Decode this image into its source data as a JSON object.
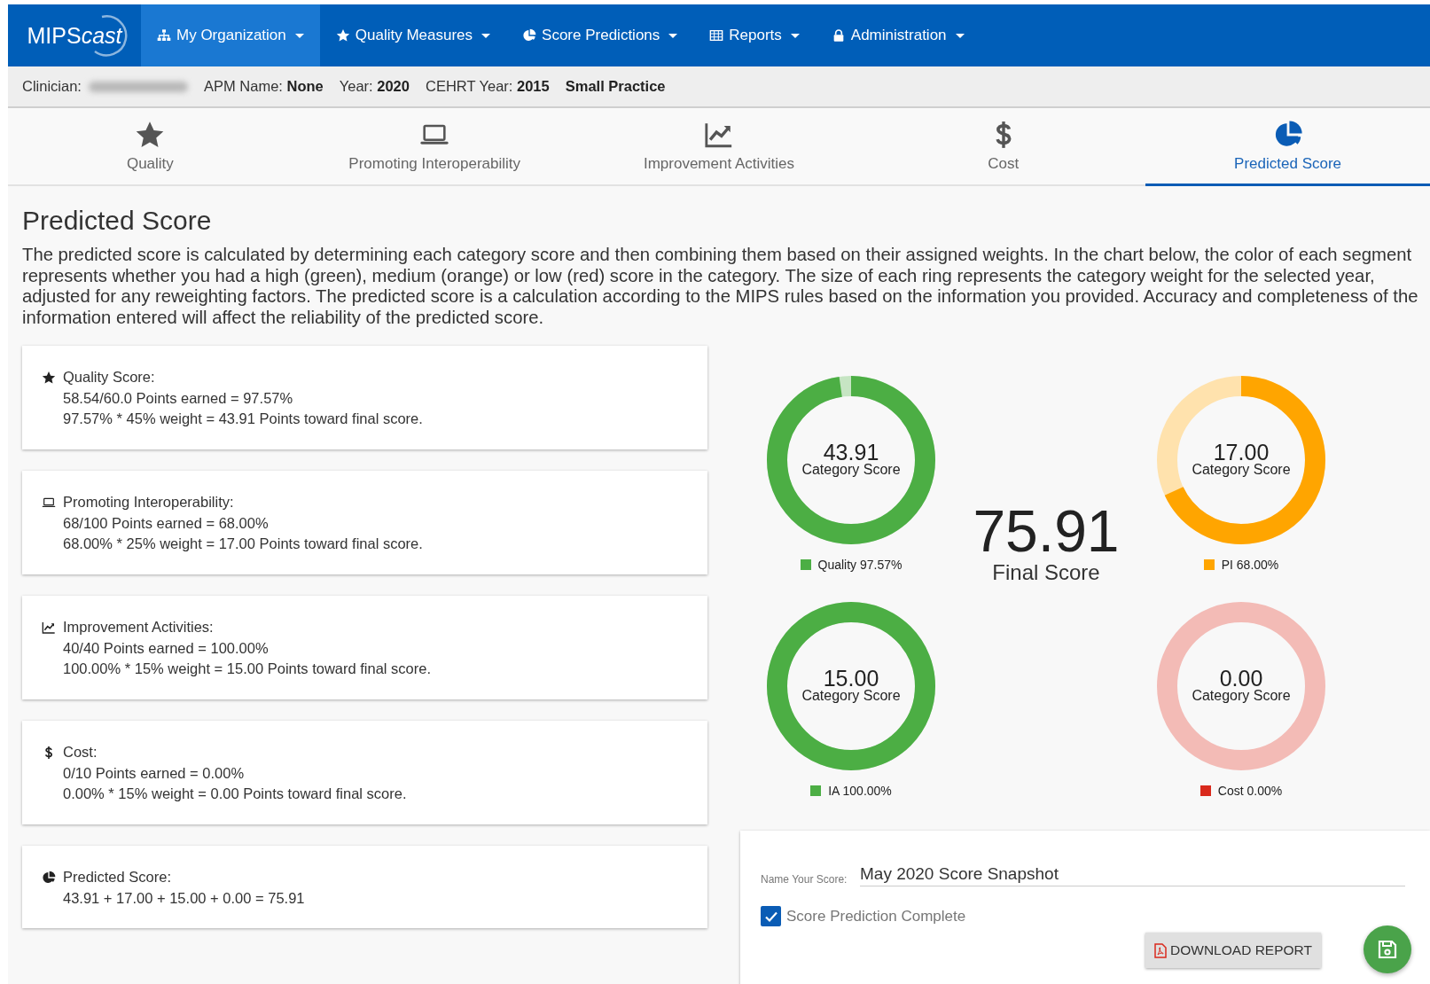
{
  "nav": {
    "logo": {
      "text": "MIPS",
      "accent": "cast"
    },
    "items": [
      {
        "label": "My Organization",
        "kind": "sitemap",
        "selected": true
      },
      {
        "label": "Quality Measures",
        "kind": "star",
        "selected": false
      },
      {
        "label": "Score Predictions",
        "kind": "pie",
        "selected": false
      },
      {
        "label": "Reports",
        "kind": "table",
        "selected": false
      },
      {
        "label": "Administration",
        "kind": "lock",
        "selected": false
      }
    ]
  },
  "info_bar": {
    "clinician_label": "Clinician:",
    "items": [
      "APM Name: **None**",
      "Year: **2020**",
      "CEHRT Year: **2015**"
    ],
    "practice_size": "Small Practice"
  },
  "tabs": [
    {
      "label": "Quality",
      "kind": "star",
      "selected": false
    },
    {
      "label": "Promoting Interoperability",
      "kind": "laptop",
      "selected": false
    },
    {
      "label": "Improvement Activities",
      "kind": "chart",
      "selected": false
    },
    {
      "label": "Cost",
      "kind": "dollar",
      "selected": false
    },
    {
      "label": "Predicted Score",
      "kind": "pie",
      "selected": true
    }
  ],
  "heading": "Predicted Score",
  "description": [
    "The predicted score is calculated by determining each category score and then combining them based on their assigned weights. In the chart below, the color of each segment",
    "represents whether you had a high (green), medium (orange) or low (red) score in the category. The size of each ring represents the category weight for the selected year,",
    "adjusted for any reweighting factors. The predicted score is a calculation according to the MIPS rules based on the information you provided. Accuracy and completeness of the",
    "information entered will affect the reliability of the predicted score."
  ],
  "cards": [
    {
      "kind": "star",
      "title": "Quality Score:",
      "lines": [
        "58.54/60.0 Points earned = 97.57%",
        "97.57% * 45% weight = 43.91 Points toward final score."
      ]
    },
    {
      "kind": "laptop",
      "title": "Promoting Interoperability:",
      "lines": [
        "68/100 Points earned = 68.00%",
        "68.00% * 25% weight = 17.00 Points toward final score."
      ]
    },
    {
      "kind": "chart",
      "title": "Improvement Activities:",
      "lines": [
        "40/40 Points earned = 100.00%",
        "100.00% * 15% weight = 15.00 Points toward final score."
      ]
    },
    {
      "kind": "dollar",
      "title": "Cost:",
      "lines": [
        "0/10 Points earned = 0.00%",
        "0.00% * 15% weight = 0.00 Points toward final score."
      ]
    },
    {
      "kind": "pie",
      "title": "Predicted Score:",
      "lines": [
        "43.91 + 17.00 + 15.00 + 0.00 = 75.91"
      ]
    }
  ],
  "rings": [
    {
      "value": "43.91",
      "caption": "Category Score",
      "legend": "Quality 97.57%",
      "level": 0.9757,
      "color": "#4cae44"
    },
    {
      "value": "17.00",
      "caption": "Category Score",
      "legend": "PI 68.00%",
      "level": 0.68,
      "color": "#ffa500"
    },
    {
      "value": "15.00",
      "caption": "Category Score",
      "legend": "IA 100.00%",
      "level": 1,
      "color": "#4cae44"
    },
    {
      "value": "0.00",
      "caption": "Category Score",
      "legend": "Cost 0.00%",
      "level": 0,
      "color": "#d9291c"
    }
  ],
  "final_score": {
    "value": "75.91",
    "label": "Final Score"
  },
  "form": {
    "name_label": "Name Your Score:",
    "name_value": "May 2020 Score Snapshot",
    "checkbox": {
      "label": "Score Prediction Complete",
      "checked": true
    },
    "download_button": "DOWNLOAD REPORT"
  }
}
